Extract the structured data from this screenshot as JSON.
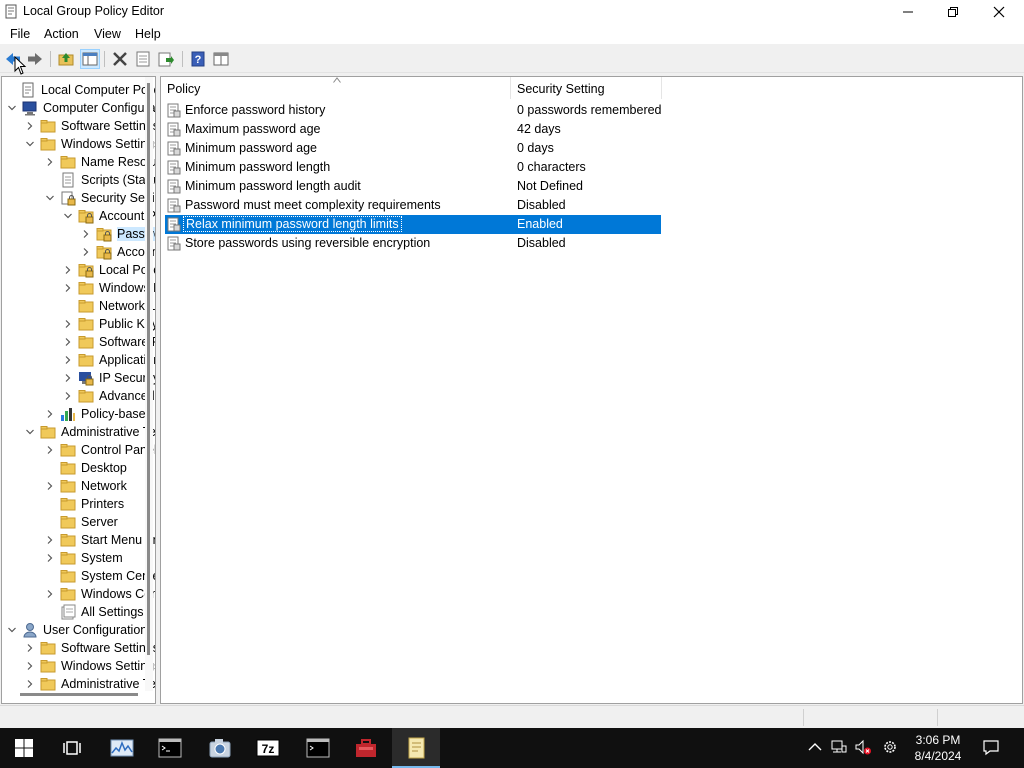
{
  "window": {
    "title": "Local Group Policy Editor"
  },
  "menu": {
    "file": "File",
    "action": "Action",
    "view": "View",
    "help": "Help"
  },
  "toolbar": {
    "icons": [
      "back-arrow-icon",
      "forward-arrow-icon",
      "up-folder-icon",
      "show-hide-tree-icon",
      "delete-icon",
      "properties-icon",
      "export-list-icon",
      "help-icon",
      "console-tree-icon"
    ]
  },
  "tree": [
    {
      "label": "Local Computer Policy",
      "icon": "policy-scroll-icon"
    },
    {
      "label": "Computer Configuration",
      "icon": "computer-icon"
    },
    {
      "label": "Software Settings",
      "icon": "folder-icon"
    },
    {
      "label": "Windows Settings",
      "icon": "folder-icon"
    },
    {
      "label": "Name Resolution Policy",
      "icon": "folder-icon"
    },
    {
      "label": "Scripts (Startup/Shutdown)",
      "icon": "script-icon"
    },
    {
      "label": "Security Settings",
      "icon": "security-icon"
    },
    {
      "label": "Account Policies",
      "icon": "locked-folder-icon"
    },
    {
      "label": "Password Policy",
      "icon": "locked-folder-icon"
    },
    {
      "label": "Account Lockout Policy",
      "icon": "locked-folder-icon"
    },
    {
      "label": "Local Policies",
      "icon": "locked-folder-icon"
    },
    {
      "label": "Windows Defender Firewall",
      "icon": "folder-icon"
    },
    {
      "label": "Network List Manager Policies",
      "icon": "folder-icon"
    },
    {
      "label": "Public Key Policies",
      "icon": "folder-icon"
    },
    {
      "label": "Software Restriction Policies",
      "icon": "folder-icon"
    },
    {
      "label": "Application Control Policies",
      "icon": "folder-icon"
    },
    {
      "label": "IP Security Policies",
      "icon": "ip-security-icon"
    },
    {
      "label": "Advanced Audit Policy Configuration",
      "icon": "folder-icon"
    },
    {
      "label": "Policy-based QoS",
      "icon": "bar-chart-icon"
    },
    {
      "label": "Administrative Templates",
      "icon": "folder-icon"
    },
    {
      "label": "Control Panel",
      "icon": "folder-icon"
    },
    {
      "label": "Desktop",
      "icon": "folder-icon"
    },
    {
      "label": "Network",
      "icon": "folder-icon"
    },
    {
      "label": "Printers",
      "icon": "folder-icon"
    },
    {
      "label": "Server",
      "icon": "folder-icon"
    },
    {
      "label": "Start Menu and Taskbar",
      "icon": "folder-icon"
    },
    {
      "label": "System",
      "icon": "folder-icon"
    },
    {
      "label": "System Center",
      "icon": "folder-icon"
    },
    {
      "label": "Windows Components",
      "icon": "folder-icon"
    },
    {
      "label": "All Settings",
      "icon": "all-settings-icon"
    },
    {
      "label": "User Configuration",
      "icon": "user-icon"
    },
    {
      "label": "Software Settings",
      "icon": "folder-icon"
    },
    {
      "label": "Windows Settings",
      "icon": "folder-icon"
    },
    {
      "label": "Administrative Templates",
      "icon": "folder-icon"
    }
  ],
  "columns": {
    "policy": "Policy",
    "setting": "Security Setting"
  },
  "policies": [
    {
      "policy": "Enforce password history",
      "setting": "0 passwords remembered"
    },
    {
      "policy": "Maximum password age",
      "setting": "42 days"
    },
    {
      "policy": "Minimum password age",
      "setting": "0 days"
    },
    {
      "policy": "Minimum password length",
      "setting": "0 characters"
    },
    {
      "policy": "Minimum password length audit",
      "setting": "Not Defined"
    },
    {
      "policy": "Password must meet complexity requirements",
      "setting": "Disabled"
    },
    {
      "policy": "Relax minimum password length limits",
      "setting": "Enabled"
    },
    {
      "policy": "Store passwords using reversible encryption",
      "setting": "Disabled"
    }
  ],
  "taskbar": {
    "apps": [
      "performance-monitor-icon",
      "command-prompt-icon",
      "camera-icon",
      "7zip-icon",
      "terminal-icon",
      "toolbox-icon",
      "group-policy-icon"
    ],
    "clock": {
      "time": "3:06 PM",
      "date": "8/4/2024"
    }
  },
  "colors": {
    "selection": "#0078d7",
    "tree_selection": "#cce8ff",
    "taskbar": "#101010"
  }
}
